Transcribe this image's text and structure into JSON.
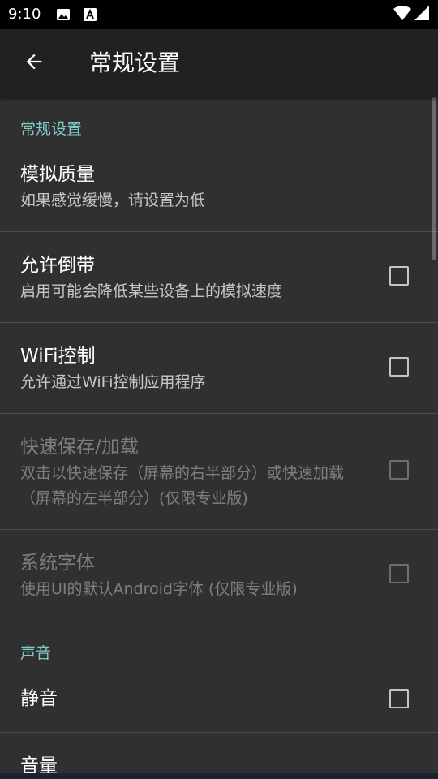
{
  "status_bar": {
    "time": "9:10",
    "notification_icons": [
      "image-icon",
      "text-a-icon"
    ],
    "system_icons": [
      "wifi-icon",
      "signal-icon"
    ]
  },
  "app_bar": {
    "title": "常规设置",
    "back_icon": "arrow-left-icon"
  },
  "colors": {
    "accent": "#80cbc4",
    "background": "#303030",
    "app_bar": "#212121",
    "status_bar": "#000000"
  },
  "sections": [
    {
      "header": "常规设置",
      "items": [
        {
          "title": "模拟质量",
          "summary": "如果感觉缓慢，请设置为低",
          "has_checkbox": false,
          "checked": false,
          "enabled": true
        },
        {
          "title": "允许倒带",
          "summary": "启用可能会降低某些设备上的模拟速度",
          "has_checkbox": true,
          "checked": false,
          "enabled": true
        },
        {
          "title": "WiFi控制",
          "summary": "允许通过WiFi控制应用程序",
          "has_checkbox": true,
          "checked": false,
          "enabled": true
        },
        {
          "title": "快速保存/加载",
          "summary": "双击以快速保存（屏幕的右半部分）或快速加载（屏幕的左半部分）(仅限专业版)",
          "has_checkbox": true,
          "checked": false,
          "enabled": false
        },
        {
          "title": "系统字体",
          "summary": "使用UI的默认Android字体 (仅限专业版)",
          "has_checkbox": true,
          "checked": false,
          "enabled": false
        }
      ]
    },
    {
      "header": "声音",
      "items": [
        {
          "title": "静音",
          "summary": "",
          "has_checkbox": true,
          "checked": false,
          "enabled": true
        },
        {
          "title": "音量",
          "summary": "",
          "has_checkbox": false,
          "checked": false,
          "enabled": true
        }
      ]
    }
  ]
}
